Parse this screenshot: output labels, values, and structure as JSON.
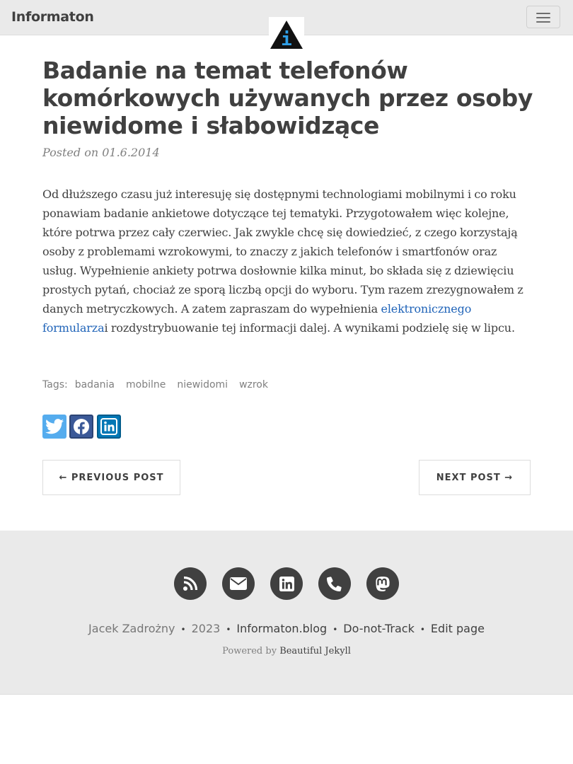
{
  "navbar": {
    "brand": "Informaton",
    "logo_letter": "i"
  },
  "post": {
    "title": "Badanie na temat telefonów komórkowych używanych przez osoby niewidome i słabowidzące",
    "meta": "Posted on 01.6.2014",
    "body_before_link": "Od dłuższego czasu już interesuję się dostępnymi technologiami mobilnymi i co roku ponawiam badanie ankietowe dotyczące tej tematyki. Przygotowałem więc kolejne, które potrwa przez cały czerwiec. Jak zwykle chcę się dowiedzieć, z czego korzystają osoby z problemami wzrokowymi, to znaczy z jakich telefonów i smartfonów oraz usług. Wypełnienie ankiety potrwa dosłownie kilka minut, bo składa się z dziewięciu prostych pytań, chociaż ze sporą liczbą opcji do wyboru. Tym razem zrezygnowałem z danych metryczkowych. A zatem zapraszam do wypełnienia ",
    "link_text": "elektronicznego formularza",
    "body_after_link": "i rozdystrybuowanie tej informacji dalej. A wynikami podzielę się w lipcu."
  },
  "tags": {
    "label": "Tags:",
    "items": [
      "badania",
      "mobilne",
      "niewidomi",
      "wzrok"
    ]
  },
  "share": {
    "icons": [
      "twitter-icon",
      "facebook-icon",
      "linkedin-icon"
    ],
    "colors": {
      "twitter": "#55acee",
      "facebook": "#3b5998",
      "linkedin": "#0077b5"
    }
  },
  "pager": {
    "previous": "← PREVIOUS POST",
    "next": "NEXT POST →"
  },
  "footer": {
    "social_icons": [
      "rss-icon",
      "envelope-icon",
      "linkedin-icon",
      "phone-icon",
      "mastodon-icon"
    ],
    "author": "Jacek Zadrożny",
    "year": "2023",
    "site": "Informaton.blog",
    "dnt": "Do-not-Track",
    "edit": "Edit page",
    "powered_prefix": "Powered by",
    "powered_link": "Beautiful Jekyll"
  }
}
